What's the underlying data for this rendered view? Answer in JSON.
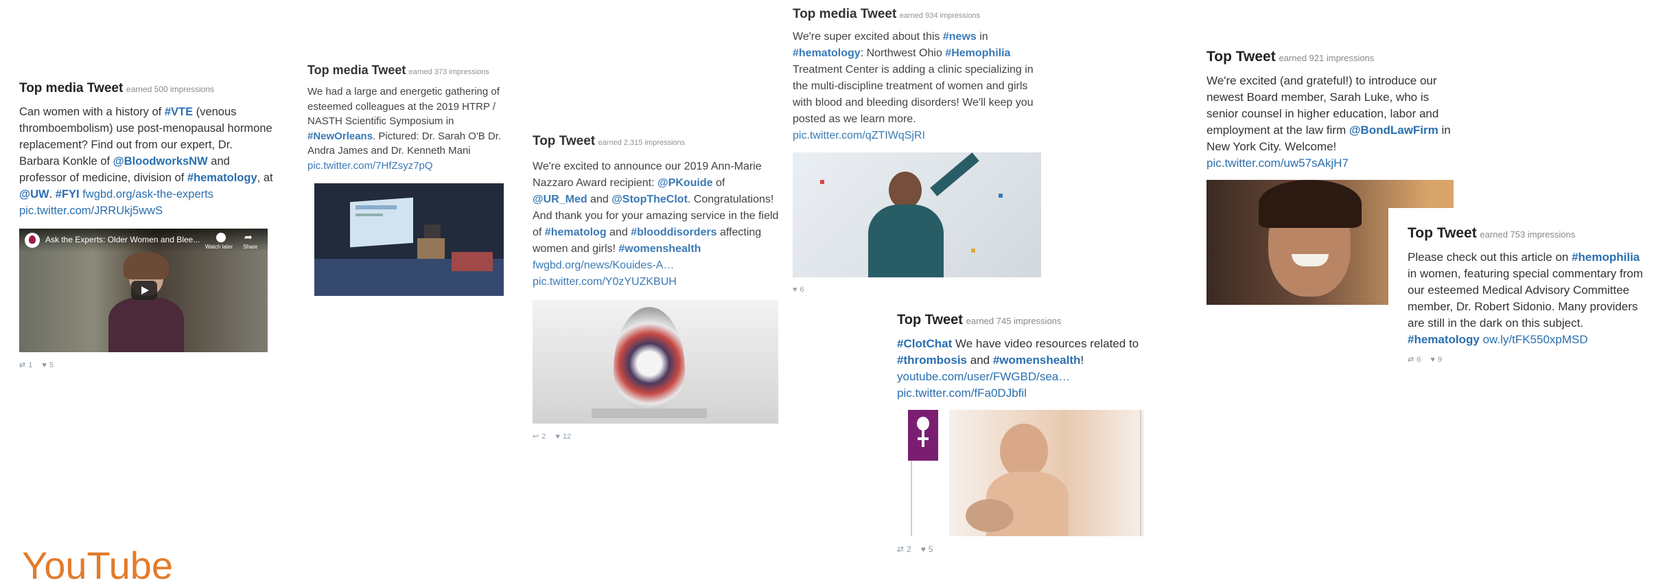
{
  "colors": {
    "link": "#2a6fb0",
    "earned": "#888888",
    "orange": "#e37b2b"
  },
  "tweets": [
    {
      "header": "Top media Tweet",
      "earned": "earned 500 impressions",
      "text": [
        {
          "t": "Can women with a history of "
        },
        {
          "t": "#VTE",
          "k": "tag"
        },
        {
          "t": " (venous thromboembolism) use post-menopausal hormone replacement? Find out from our expert, Dr. Barbara Konkle of "
        },
        {
          "t": "@BloodworksNW",
          "k": "tag"
        },
        {
          "t": " and professor of medicine, division of "
        },
        {
          "t": "#hematology",
          "k": "tag"
        },
        {
          "t": ", at "
        },
        {
          "t": "@UW",
          "k": "tag"
        },
        {
          "t": ". "
        },
        {
          "t": "#FYI",
          "k": "tag"
        },
        {
          "t": " "
        },
        {
          "t": "fwgbd.org/ask-the-experts",
          "k": "link"
        },
        {
          "t": " "
        },
        {
          "t": "pic.twitter.com/JRRUkj5wwS",
          "k": "link"
        }
      ],
      "media_caption": "Ask the Experts: Older Women and Blee...",
      "media_watch": "Watch later",
      "media_share": "Share",
      "retweets": "1",
      "likes": "5"
    },
    {
      "header": "Top media Tweet",
      "earned": "earned 373 impressions",
      "text": [
        {
          "t": "We had a large and energetic gathering of esteemed colleagues at the 2019 HTRP / NASTH Scientific Symposium in "
        },
        {
          "t": "#NewOrleans",
          "k": "tag"
        },
        {
          "t": ". Pictured: Dr. Sarah O'B Dr. Andra James and Dr. Kenneth Mani "
        },
        {
          "t": "pic.twitter.com/7HfZsyz7pQ",
          "k": "link"
        }
      ]
    },
    {
      "header": "Top Tweet",
      "earned": "earned 2,315 impressions",
      "text": [
        {
          "t": "We're excited to announce our 2019 Ann-Marie Nazzaro Award recipient: "
        },
        {
          "t": "@PKouide",
          "k": "tag"
        },
        {
          "t": " of "
        },
        {
          "t": "@UR_Med",
          "k": "tag"
        },
        {
          "t": " and "
        },
        {
          "t": "@StopTheClot",
          "k": "tag"
        },
        {
          "t": ". Congratulations! And thank you for your amazing service in the field of "
        },
        {
          "t": "#hematolog",
          "k": "tag"
        },
        {
          "t": " and "
        },
        {
          "t": "#blooddisorders",
          "k": "tag"
        },
        {
          "t": " affecting women and girls! "
        },
        {
          "t": "#womenshealth",
          "k": "tag"
        },
        {
          "t": " "
        },
        {
          "t": "fwgbd.org/news/Kouides-A…",
          "k": "link"
        },
        {
          "t": " "
        },
        {
          "t": "pic.twitter.com/Y0zYUZKBUH",
          "k": "link"
        }
      ],
      "retweets": "2",
      "likes": "12"
    },
    {
      "header": "Top media Tweet",
      "earned": "earned 934 impressions",
      "text": [
        {
          "t": "We're super excited about this "
        },
        {
          "t": "#news",
          "k": "tag"
        },
        {
          "t": " in "
        },
        {
          "t": "#hematology",
          "k": "tag"
        },
        {
          "t": ": Northwest Ohio "
        },
        {
          "t": "#Hemophilia",
          "k": "tag"
        },
        {
          "t": " Treatment Center is adding a clinic specializing in the multi-discipline treatment of women and girls with blood and bleeding disorders! We'll keep you posted as we learn more. "
        },
        {
          "t": "pic.twitter.com/qZTIWqSjRI",
          "k": "link"
        }
      ],
      "likes": "6"
    },
    {
      "header": "Top Tweet",
      "earned": "earned 745 impressions",
      "text": [
        {
          "t": "#ClotChat",
          "k": "tag"
        },
        {
          "t": " We have video resources related to "
        },
        {
          "t": "#thrombosis",
          "k": "tag"
        },
        {
          "t": " and "
        },
        {
          "t": "#womenshealth",
          "k": "tag"
        },
        {
          "t": "! "
        },
        {
          "t": "youtube.com/user/FWGBD/sea…",
          "k": "link"
        },
        {
          "t": " "
        },
        {
          "t": "pic.twitter.com/fFa0DJbfil",
          "k": "link"
        }
      ],
      "retweets": "2",
      "likes": "5"
    },
    {
      "header": "Top Tweet",
      "earned": "earned 921 impressions",
      "text": [
        {
          "t": "We're excited (and grateful!) to introduce our newest Board member, Sarah Luke, who is senior counsel in higher education, labor and employment at the law firm "
        },
        {
          "t": "@BondLawFirm",
          "k": "tag"
        },
        {
          "t": " in New York City. Welcome! "
        },
        {
          "t": "pic.twitter.com/uw57sAkjH7",
          "k": "link"
        }
      ]
    },
    {
      "header": "Top Tweet",
      "earned": "earned 753 impressions",
      "text": [
        {
          "t": "Please check out this article on "
        },
        {
          "t": "#hemophilia",
          "k": "tag"
        },
        {
          "t": " in women, featuring special commentary from our esteemed Medical Advisory Committee member, Dr. Robert Sidonio. Many providers are still in the dark on this subject. "
        },
        {
          "t": "#hematology",
          "k": "tag"
        },
        {
          "t": " "
        },
        {
          "t": "ow.ly/tFK550xpMSD",
          "k": "link"
        }
      ],
      "retweets": "6",
      "likes": "9"
    }
  ],
  "section_title": "YouTube"
}
